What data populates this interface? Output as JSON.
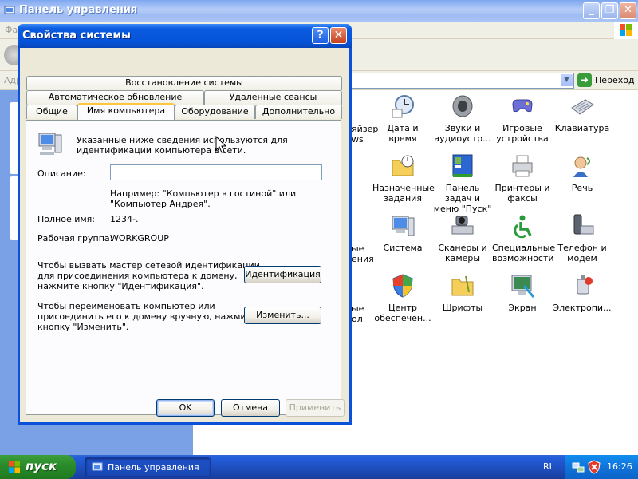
{
  "colors": {
    "xp_blue": "#0a50d8",
    "dialog_face": "#ece9d8",
    "tab_hot": "#ffc83c",
    "start_green": "#2a8c2a",
    "left_pane": "#7aa1e6"
  },
  "control_panel": {
    "title": "Панель управления",
    "menu_file": "Фа",
    "address_label": "Адр",
    "go_label": "Переход",
    "left_partials": [
      "яйзер",
      "ws",
      "ые",
      "ения",
      "ые",
      "ол"
    ],
    "icons": [
      {
        "name": "datetime",
        "icon": "clock-icon",
        "label": "Дата и время"
      },
      {
        "name": "sounds",
        "icon": "speaker-icon",
        "label": "Звуки и аудиоустр..."
      },
      {
        "name": "gamecontrollers",
        "icon": "gamepad-icon",
        "label": "Игровые устройства"
      },
      {
        "name": "keyboard",
        "icon": "keyboard-icon",
        "label": "Клавиатура"
      },
      {
        "name": "scheduledtasks",
        "icon": "folder-clock-icon",
        "label": "Назначенные задания"
      },
      {
        "name": "taskbar",
        "icon": "taskbar-icon",
        "label": "Панель задач и меню \"Пуск\""
      },
      {
        "name": "printers",
        "icon": "printer-icon",
        "label": "Принтеры и факсы"
      },
      {
        "name": "speech",
        "icon": "speech-icon",
        "label": "Речь"
      },
      {
        "name": "system",
        "icon": "computer-icon",
        "label": "Система"
      },
      {
        "name": "scanners",
        "icon": "scanner-icon",
        "label": "Сканеры и камеры"
      },
      {
        "name": "accessibility",
        "icon": "accessibility-icon",
        "label": "Специальные возможности"
      },
      {
        "name": "phone",
        "icon": "phone-modem-icon",
        "label": "Телефон и модем"
      },
      {
        "name": "security",
        "icon": "shield-icon",
        "label": "Центр обеспечен..."
      },
      {
        "name": "fonts",
        "icon": "fonts-folder-icon",
        "label": "Шрифты"
      },
      {
        "name": "display",
        "icon": "display-icon",
        "label": "Экран"
      },
      {
        "name": "power",
        "icon": "power-icon",
        "label": "Электропи..."
      }
    ]
  },
  "dialog": {
    "title": "Свойства системы",
    "tabs_row1": [
      "Восстановление системы"
    ],
    "tabs_row2": [
      "Автоматическое обновление",
      "Удаленные сеансы"
    ],
    "tabs_row3": [
      "Общие",
      "Имя компьютера",
      "Оборудование",
      "Дополнительно"
    ],
    "active_tab": "Имя компьютера",
    "intro_line1": "Указанные ниже сведения используются для",
    "intro_line2": "идентификации компьютера в сети.",
    "description_label": "Описание:",
    "description_value": "",
    "example_line1": "Например: \"Компьютер в гостиной\" или",
    "example_line2": "\"Компьютер Андрея\".",
    "fullname_label": "Полное имя:",
    "fullname_value": "1234-.",
    "workgroup_label": "Рабочая группа:",
    "workgroup_value": "WORKGROUP",
    "wizard_line1": "Чтобы вызвать мастер сетевой идентификации",
    "wizard_line2": "для присоединения компьютера к домену,",
    "wizard_line3": "нажмите кнопку \"Идентификация\".",
    "identify_button": "Идентификация",
    "rename_line1": "Чтобы переименовать компьютер или",
    "rename_line2": "присоединить его к домену вручную, нажмите",
    "rename_line3": "кнопку \"Изменить\".",
    "change_button": "Изменить...",
    "ok_button": "OK",
    "cancel_button": "Отмена",
    "apply_button": "Применить"
  },
  "taskbar": {
    "start_label": "пуск",
    "task_label": "Панель управления",
    "language": "RL",
    "clock": "16:26"
  }
}
